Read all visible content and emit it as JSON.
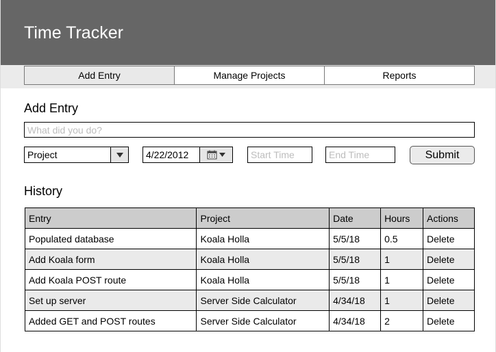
{
  "app": {
    "title": "Time Tracker"
  },
  "nav": {
    "tabs": [
      {
        "label": "Add Entry",
        "active": true
      },
      {
        "label": "Manage Projects",
        "active": false
      },
      {
        "label": "Reports",
        "active": false
      }
    ]
  },
  "add_entry": {
    "heading": "Add Entry",
    "entry_placeholder": "What did you do?",
    "project_value": "Project",
    "date_value": "4/22/2012",
    "start_placeholder": "Start Time",
    "end_placeholder": "End Time",
    "submit_label": "Submit"
  },
  "history": {
    "heading": "History",
    "columns": [
      "Entry",
      "Project",
      "Date",
      "Hours",
      "Actions"
    ],
    "rows": [
      [
        "Populated database",
        "Koala Holla",
        "5/5/18",
        "0.5",
        "Delete"
      ],
      [
        "Add Koala form",
        "Koala Holla",
        "5/5/18",
        "1",
        "Delete"
      ],
      [
        "Add Koala POST route",
        "Koala Holla",
        "5/5/18",
        "1",
        "Delete"
      ],
      [
        "Set up server",
        "Server Side Calculator",
        "4/34/18",
        "1",
        "Delete"
      ],
      [
        "Added GET and POST routes",
        "Server Side Calculator",
        "4/34/18",
        "2",
        "Delete"
      ]
    ]
  },
  "icons": {
    "dropdown": "chevron-down-icon",
    "calendar": "calendar-icon"
  },
  "colors": {
    "header_bg": "#666666",
    "nav_bg": "#ebebeb",
    "active_tab": "#e9e9e9",
    "table_header": "#cccccc",
    "row_alt": "#eaeaea"
  }
}
